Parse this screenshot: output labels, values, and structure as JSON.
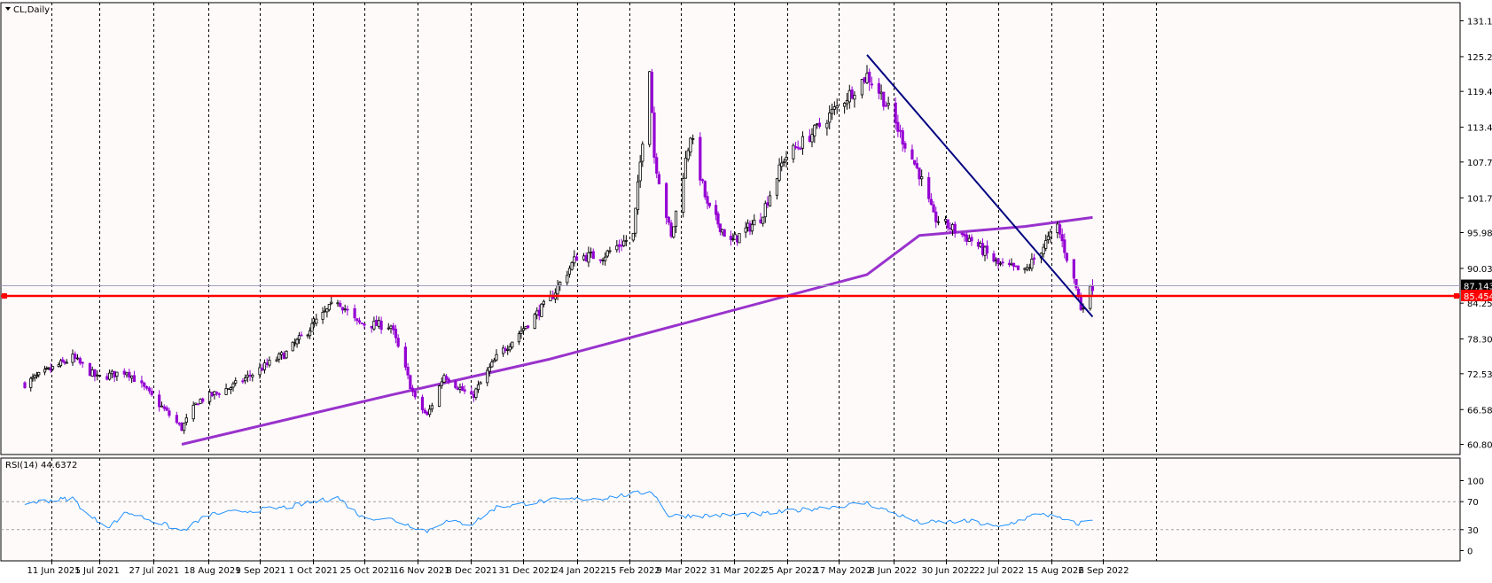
{
  "chart_data": [
    {
      "type": "candlestick",
      "title": "CL,Daily",
      "symbol": "CL",
      "timeframe": "Daily",
      "ylim": [
        58.0,
        134.5
      ],
      "y_ticks": [
        131.155,
        125.2,
        119.43,
        113.48,
        107.705,
        101.75,
        95.98,
        90.03,
        84.255,
        78.305,
        72.53,
        66.58,
        60.805
      ],
      "x_ticks": [
        "11 Jun 2021",
        "5 Jul 2021",
        "27 Jul 2021",
        "18 Aug 2021",
        "9 Sep 2021",
        "1 Oct 2021",
        "25 Oct 2021",
        "16 Nov 2021",
        "8 Dec 2021",
        "31 Dec 2021",
        "24 Jan 2022",
        "15 Feb 2022",
        "9 Mar 2022",
        "31 Mar 2022",
        "25 Apr 2022",
        "17 May 2022",
        "8 Jun 2022",
        "30 Jun 2022",
        "22 Jul 2022",
        "15 Aug 2022",
        "6 Sep 2022"
      ],
      "grid": true,
      "current_price": 87.143,
      "current_price_label": "87.143",
      "horizontal_line": {
        "value": 85.454,
        "label": "85.454",
        "color": "#ff0000"
      },
      "trendline": {
        "from": [
          "8 Jun 2022",
          125.5
        ],
        "to": [
          "13 Sep 2022",
          82.0
        ],
        "color": "#000080"
      },
      "moving_average": {
        "color": "#9932cc",
        "x": [
          "18 Aug 2021",
          "16 Nov 2021",
          "24 Jan 2022",
          "8 Jun 2022",
          "30 Jun 2022",
          "15 Aug 2022",
          "13 Sep 2022"
        ],
        "values": [
          60.805,
          69.0,
          75.0,
          89.0,
          95.5,
          97.0,
          98.5
        ]
      },
      "candles": {
        "up_color": "#000000",
        "down_color": "#9400d3",
        "approx_close_path": [
          [
            "11 Jun 2021",
            70.9
          ],
          [
            "5 Jul 2021",
            75.2
          ],
          [
            "15 Jul 2021",
            71.8
          ],
          [
            "27 Jul 2021",
            73.0
          ],
          [
            "2 Aug 2021",
            70.5
          ],
          [
            "18 Aug 2021",
            63.5
          ],
          [
            "25 Aug 2021",
            68.0
          ],
          [
            "9 Sep 2021",
            70.5
          ],
          [
            "1 Oct 2021",
            76.0
          ],
          [
            "25 Oct 2021",
            84.8
          ],
          [
            "2 Nov 2021",
            80.9
          ],
          [
            "16 Nov 2021",
            80.5
          ],
          [
            "26 Nov 2021",
            68.2
          ],
          [
            "1 Dec 2021",
            65.5
          ],
          [
            "8 Dec 2021",
            72.4
          ],
          [
            "20 Dec 2021",
            68.5
          ],
          [
            "31 Dec 2021",
            75.2
          ],
          [
            "24 Jan 2022",
            85.0
          ],
          [
            "4 Feb 2022",
            92.0
          ],
          [
            "15 Feb 2022",
            92.1
          ],
          [
            "28 Feb 2022",
            95.5
          ],
          [
            "7 Mar 2022",
            123.7
          ],
          [
            "9 Mar 2022",
            108.7
          ],
          [
            "16 Mar 2022",
            95.0
          ],
          [
            "24 Mar 2022",
            112.3
          ],
          [
            "31 Mar 2022",
            100.3
          ],
          [
            "11 Apr 2022",
            94.3
          ],
          [
            "25 Apr 2022",
            98.5
          ],
          [
            "5 May 2022",
            108.3
          ],
          [
            "17 May 2022",
            112.4
          ],
          [
            "8 Jun 2022",
            122.1
          ],
          [
            "14 Jun 2022",
            118.9
          ],
          [
            "30 Jun 2022",
            105.8
          ],
          [
            "6 Jul 2022",
            98.5
          ],
          [
            "22 Jul 2022",
            94.7
          ],
          [
            "3 Aug 2022",
            90.7
          ],
          [
            "15 Aug 2022",
            89.4
          ],
          [
            "29 Aug 2022",
            97.0
          ],
          [
            "6 Sep 2022",
            86.8
          ],
          [
            "8 Sep 2022",
            83.5
          ],
          [
            "13 Sep 2022",
            87.1
          ]
        ]
      }
    },
    {
      "type": "line",
      "title": "RSI(14) 44.6372",
      "ylim": [
        0,
        100
      ],
      "y_ticks": [
        100,
        70,
        30,
        0
      ],
      "levels": [
        70,
        30
      ],
      "series": [
        {
          "color": "#1e90ff",
          "points": [
            [
              "11 Jun 2021",
              68
            ],
            [
              "5 Jul 2021",
              75
            ],
            [
              "12 Jul 2021",
              48
            ],
            [
              "20 Jul 2021",
              35
            ],
            [
              "27 Jul 2021",
              55
            ],
            [
              "9 Aug 2021",
              40
            ],
            [
              "18 Aug 2021",
              28
            ],
            [
              "30 Aug 2021",
              52
            ],
            [
              "9 Sep 2021",
              55
            ],
            [
              "1 Oct 2021",
              62
            ],
            [
              "25 Oct 2021",
              76
            ],
            [
              "4 Nov 2021",
              48
            ],
            [
              "16 Nov 2021",
              45
            ],
            [
              "1 Dec 2021",
              28
            ],
            [
              "8 Dec 2021",
              42
            ],
            [
              "20 Dec 2021",
              38
            ],
            [
              "31 Dec 2021",
              62
            ],
            [
              "24 Jan 2022",
              72
            ],
            [
              "15 Feb 2022",
              75
            ],
            [
              "8 Mar 2022",
              85
            ],
            [
              "15 Mar 2022",
              50
            ],
            [
              "31 Mar 2022",
              50
            ],
            [
              "25 Apr 2022",
              52
            ],
            [
              "17 May 2022",
              60
            ],
            [
              "8 Jun 2022",
              68
            ],
            [
              "30 Jun 2022",
              40
            ],
            [
              "22 Jul 2022",
              42
            ],
            [
              "3 Aug 2022",
              33
            ],
            [
              "15 Aug 2022",
              46
            ],
            [
              "22 Aug 2022",
              54
            ],
            [
              "6 Sep 2022",
              38
            ],
            [
              "13 Sep 2022",
              44.6
            ]
          ]
        }
      ]
    }
  ]
}
